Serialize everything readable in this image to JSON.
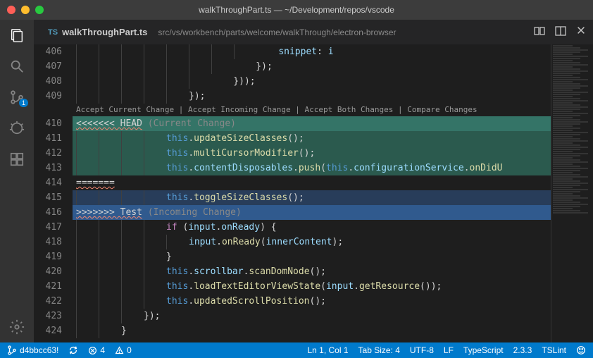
{
  "window": {
    "title": "walkThroughPart.ts — ~/Development/repos/vscode"
  },
  "activityBar": {
    "scmBadge": "1"
  },
  "tab": {
    "iconLabel": "TS",
    "filename": "walkThroughPart.ts",
    "breadcrumb": "src/vs/workbench/parts/welcome/walkThrough/electron-browser"
  },
  "codelens": {
    "acceptCurrent": "Accept Current Change",
    "acceptIncoming": "Accept Incoming Change",
    "acceptBoth": "Accept Both Changes",
    "compare": "Compare Changes",
    "separator": " | "
  },
  "lines": {
    "n406": "406",
    "n407": "407",
    "n408": "408",
    "n409": "409",
    "n410": "410",
    "n411": "411",
    "n412": "412",
    "n413": "413",
    "n414": "414",
    "n415": "415",
    "n416": "416",
    "n417": "417",
    "n418": "418",
    "n419": "419",
    "n420": "420",
    "n421": "421",
    "n422": "422",
    "n423": "423",
    "n424": "424"
  },
  "code": {
    "l406_snippet": "snippet",
    "l406_i": "i",
    "conflict_start": "<<<<<<< HEAD",
    "conflict_start_label": " (Current Change)",
    "this": "this",
    "updateSizeClasses": "updateSizeClasses",
    "multiCursorModifier": "multiCursorModifier",
    "contentDisposables": "contentDisposables",
    "push": "push",
    "configurationService": "configurationService",
    "onDidU": "onDidU",
    "separator": "=======",
    "toggleSizeClasses": "toggleSizeClasses",
    "conflict_end": ">>>>>>> Test",
    "conflict_end_label": " (Incoming Change)",
    "if": "if",
    "input": "input",
    "onReady": "onReady",
    "innerContent": "innerContent",
    "scrollbar": "scrollbar",
    "scanDomNode": "scanDomNode",
    "loadTextEditorViewState": "loadTextEditorViewState",
    "getResource": "getResource",
    "updatedScrollPosition": "updatedScrollPosition"
  },
  "status": {
    "branch": "d4bbcc63!",
    "sync": "0",
    "errors": "4",
    "warnings": "0",
    "cursor": "Ln 1, Col 1",
    "tabSize": "Tab Size: 4",
    "encoding": "UTF-8",
    "eol": "LF",
    "language": "TypeScript",
    "tsVersion": "2.3.3",
    "linter": "TSLint"
  }
}
